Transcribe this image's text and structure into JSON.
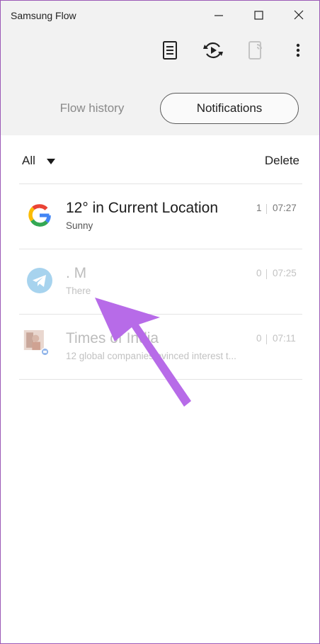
{
  "window": {
    "title": "Samsung Flow"
  },
  "toolbar": {
    "icons": [
      "notes-icon",
      "sync-icon",
      "device-icon",
      "more-icon"
    ]
  },
  "tabs": [
    {
      "label": "Flow history",
      "active": false
    },
    {
      "label": "Notifications",
      "active": true
    }
  ],
  "filter": {
    "selected": "All"
  },
  "actions": {
    "delete_label": "Delete"
  },
  "notifications": [
    {
      "app": "google-icon",
      "title": "12° in Current Location",
      "subtitle": "Sunny",
      "count": "1",
      "time": "07:27",
      "read": false
    },
    {
      "app": "telegram-icon",
      "title": ". M",
      "subtitle": "There",
      "count": "0",
      "time": "07:25",
      "read": true
    },
    {
      "app": "times-of-india-icon",
      "title": "Times of India",
      "subtitle": "12 global companies evinced interest t...",
      "count": "0",
      "time": "07:11",
      "read": true
    }
  ],
  "colors": {
    "accent_border": "#9b59b6",
    "annotation_arrow": "#b76be8"
  }
}
